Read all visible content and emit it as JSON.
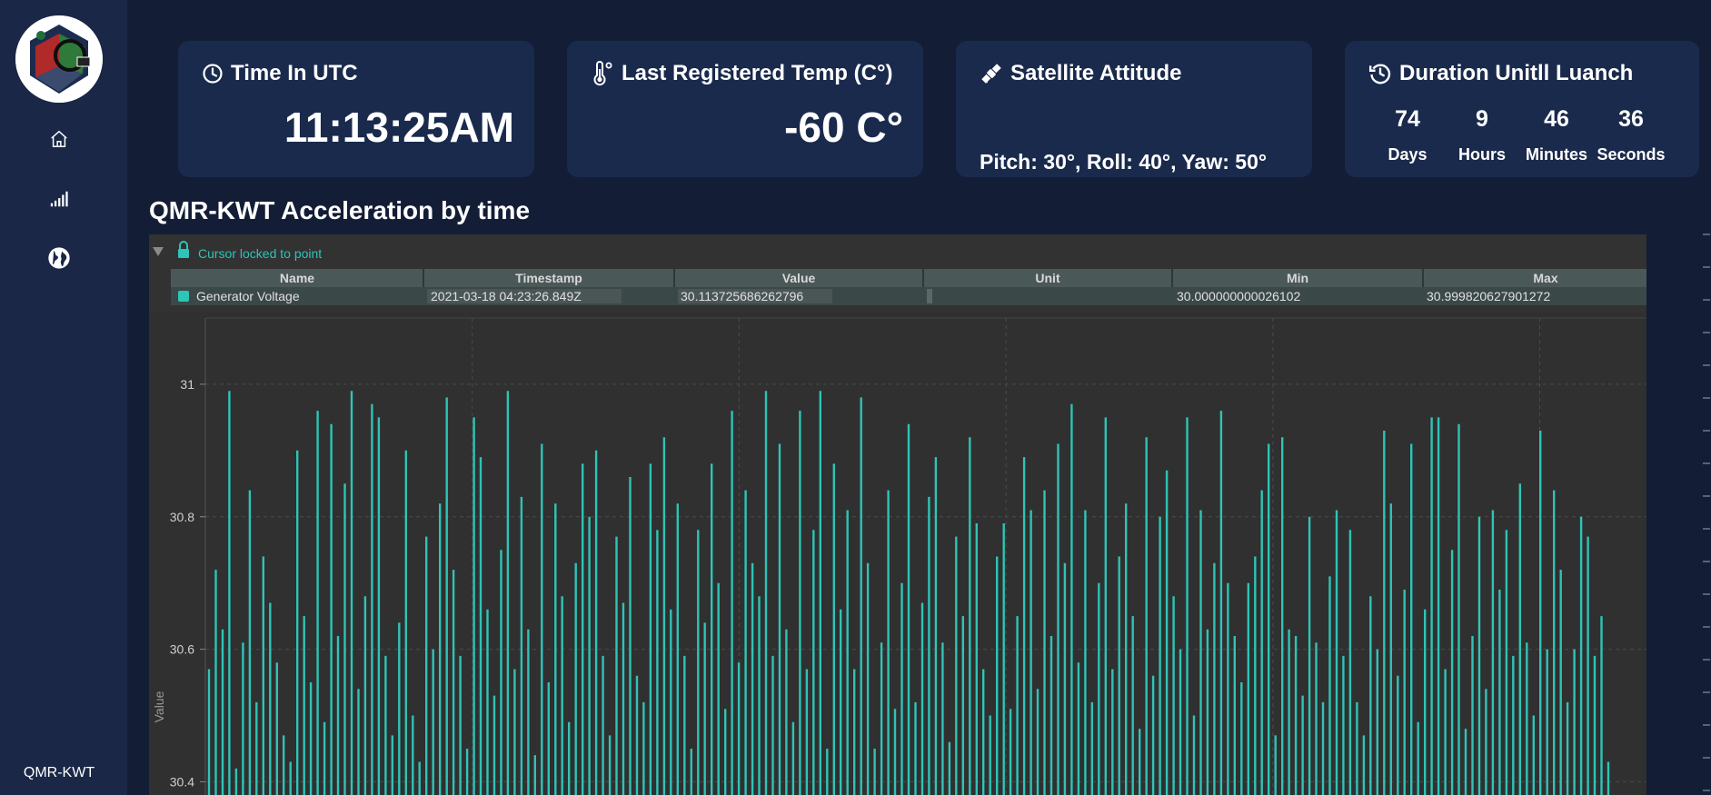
{
  "sidebar": {
    "brand": "QMR-KWT",
    "items": [
      {
        "name": "home",
        "icon": "home-icon"
      },
      {
        "name": "signal",
        "icon": "signal-icon"
      },
      {
        "name": "globe",
        "icon": "globe-icon"
      }
    ]
  },
  "cards": {
    "time": {
      "title": "Time In UTC",
      "icon": "clock-icon",
      "value": "11:13:25AM"
    },
    "temp": {
      "title": "Last Registered Temp (C°)",
      "icon": "thermometer-icon",
      "value": "-60 C°"
    },
    "attitude": {
      "title": "Satellite Attitude",
      "icon": "satellite-icon",
      "value": "Pitch: 30°, Roll: 40°, Yaw: 50°"
    },
    "countdown": {
      "title": "Duration Unitll Luanch",
      "icon": "history-icon",
      "units": [
        {
          "value": "74",
          "label": "Days"
        },
        {
          "value": "9",
          "label": "Hours"
        },
        {
          "value": "46",
          "label": "Minutes"
        },
        {
          "value": "36",
          "label": "Seconds"
        }
      ]
    }
  },
  "section_title": "QMR-KWT Acceleration by time",
  "cursor_label": "Cursor locked to point",
  "table": {
    "headers": [
      "Name",
      "Timestamp",
      "Value",
      "Unit",
      "Min",
      "Max"
    ],
    "row": {
      "name": "Generator Voltage",
      "timestamp": "2021-03-18 04:23:26.849Z",
      "value": "30.113725686262796",
      "unit": "",
      "min": "30.000000000026102",
      "max": "30.999820627901272"
    }
  },
  "colors": {
    "series": "#2ec4b6",
    "panel": "#303030",
    "background": "#131d36",
    "card": "#1a2a4c"
  },
  "chart_data": {
    "type": "bar",
    "title": "",
    "ylabel": "Value",
    "xlabel": "",
    "ylim": [
      30.38,
      31.1
    ],
    "yticks": [
      31,
      30.8,
      30.6,
      30.4
    ],
    "series": [
      {
        "name": "Generator Voltage",
        "values": [
          30.57,
          30.72,
          30.63,
          30.99,
          30.42,
          30.61,
          30.84,
          30.52,
          30.74,
          30.67,
          30.58,
          30.47,
          30.43,
          30.9,
          30.65,
          30.55,
          30.96,
          30.49,
          30.94,
          30.62,
          30.85,
          30.99,
          30.54,
          30.68,
          30.97,
          30.95,
          30.59,
          30.47,
          30.64,
          30.9,
          30.5,
          30.43,
          30.77,
          30.6,
          30.82,
          30.98,
          30.72,
          30.59,
          30.45,
          30.95,
          30.89,
          30.66,
          30.53,
          30.75,
          30.99,
          30.57,
          30.83,
          30.63,
          30.44,
          30.91,
          30.55,
          30.82,
          30.68,
          30.49,
          30.73,
          30.88,
          30.8,
          30.9,
          30.59,
          30.47,
          30.77,
          30.67,
          30.86,
          30.56,
          30.52,
          30.88,
          30.78,
          30.92,
          30.66,
          30.82,
          30.59,
          30.45,
          30.78,
          30.64,
          30.88,
          30.7,
          30.51,
          30.96,
          30.58,
          30.84,
          30.73,
          30.68,
          30.99,
          30.59,
          30.91,
          30.63,
          30.49,
          30.96,
          30.57,
          30.78,
          30.99,
          30.45,
          30.88,
          30.66,
          30.81,
          30.57,
          30.98,
          30.73,
          30.45,
          30.61,
          30.84,
          30.51,
          30.7,
          30.94,
          30.52,
          30.67,
          30.83,
          30.89,
          30.61,
          30.46,
          30.77,
          30.65,
          30.92,
          30.79,
          30.57,
          30.5,
          30.74,
          30.79,
          30.51,
          30.65,
          30.89,
          30.81,
          30.54,
          30.84,
          30.62,
          30.91,
          30.73,
          30.97,
          30.58,
          30.81,
          30.52,
          30.7,
          30.95,
          30.57,
          30.74,
          30.82,
          30.65,
          30.48,
          30.92,
          30.56,
          30.8,
          30.87,
          30.68,
          30.6,
          30.95,
          30.5,
          30.81,
          30.63,
          30.73,
          30.96,
          30.7,
          30.62,
          30.55,
          30.7,
          30.74,
          30.84,
          30.91,
          30.47,
          30.92,
          30.63,
          30.62,
          30.53,
          30.8,
          30.61,
          30.52,
          30.71,
          30.81,
          30.59,
          30.78,
          30.52,
          30.47,
          30.68,
          30.6,
          30.93,
          30.82,
          30.56,
          30.69,
          30.91,
          30.49,
          30.66,
          30.95,
          30.95,
          30.57,
          30.75,
          30.94,
          30.48,
          30.62,
          30.8,
          30.54,
          30.81,
          30.69,
          30.78,
          30.59,
          30.85,
          30.61,
          30.5,
          30.93,
          30.6,
          30.84,
          30.72,
          30.52,
          30.6,
          30.8,
          30.77,
          30.59,
          30.65,
          30.43
        ]
      }
    ]
  }
}
